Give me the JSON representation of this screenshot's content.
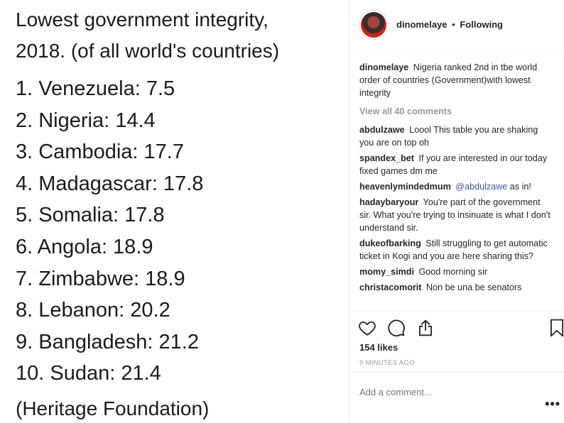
{
  "image": {
    "title_line1": "Lowest government integrity,",
    "title_line2": "2018. (of all world's countries)",
    "rows": [
      "1. Venezuela: 7.5",
      "2. Nigeria: 14.4",
      "3. Cambodia: 17.7",
      "4. Madagascar: 17.8",
      "5. Somalia: 17.8",
      "6. Angola: 18.9",
      "7. Zimbabwe: 18.9",
      "8. Lebanon: 20.2",
      "9. Bangladesh: 21.2",
      "10. Sudan: 21.4"
    ],
    "source": "(Heritage Foundation)"
  },
  "header": {
    "username": "dinomelaye",
    "separator": "•",
    "follow_status": "Following"
  },
  "caption": {
    "username": "dinomelaye",
    "text": "Nigeria ranked 2nd in tbe world order of countries (Government)with lowest integrity"
  },
  "view_all": "View all 40 comments",
  "comments": [
    {
      "user": "abdulzawe",
      "text": "Loool This table you are shaking you are on top oh"
    },
    {
      "user": "spandex_bet",
      "text": "If you are interested in our today fixed games dm me"
    },
    {
      "user": "heavenlymindedmum",
      "mention": "@abdulzawe",
      "text": "as in!"
    },
    {
      "user": "hadaybaryour",
      "text": "You're part of the government sir. What you're trying to insinuate is what I don't understand sir."
    },
    {
      "user": "dukeofbarking",
      "text": "Still struggling to get automatic ticket in Kogi and you are here sharing this?"
    },
    {
      "user": "momy_simdi",
      "text": "Good morning sir"
    },
    {
      "user": "christacomorit",
      "text": "Non be una be senators"
    }
  ],
  "actions": {
    "icons": [
      "heart-icon",
      "comment-icon",
      "share-icon",
      "bookmark-icon"
    ],
    "likes": "154 likes",
    "time": "9 MINUTES AGO"
  },
  "add_comment": {
    "placeholder": "Add a comment...",
    "more": "•••"
  }
}
